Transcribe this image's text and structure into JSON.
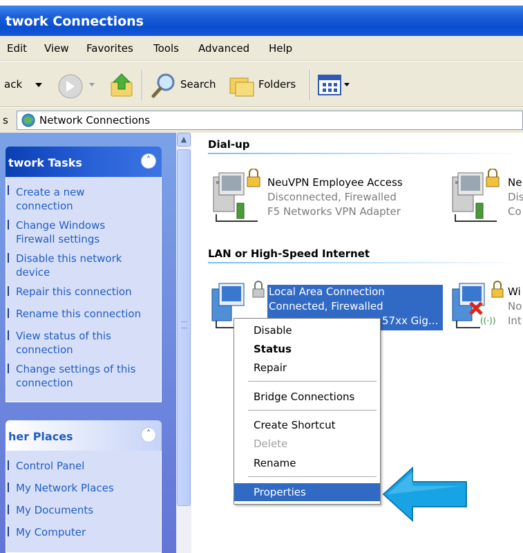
{
  "window": {
    "title": "twork Connections"
  },
  "menubar": {
    "items": [
      "Edit",
      "View",
      "Favorites",
      "Tools",
      "Advanced",
      "Help"
    ]
  },
  "toolbar": {
    "back_label": "ack",
    "search_label": "Search",
    "folders_label": "Folders"
  },
  "address": {
    "prefix": "s",
    "value": "Network Connections"
  },
  "taskpane": {
    "network_tasks": {
      "title": "twork Tasks",
      "items": [
        {
          "line1": "Create a new",
          "line2": "connection"
        },
        {
          "line1": "Change Windows",
          "line2": "Firewall settings"
        },
        {
          "line1": "Disable this network",
          "line2": "device"
        },
        {
          "line1": "Repair this connection",
          "line2": ""
        },
        {
          "line1": "Rename this connection",
          "line2": ""
        },
        {
          "line1": "View status of this",
          "line2": "connection"
        },
        {
          "line1": "Change settings of this",
          "line2": "connection"
        }
      ]
    },
    "other_places": {
      "title": "her Places",
      "items": [
        "Control Panel",
        "My Network Places",
        "My Documents",
        "My Computer"
      ]
    }
  },
  "content": {
    "groups": [
      {
        "title": "Dial-up"
      },
      {
        "title": "LAN or High-Speed Internet"
      }
    ],
    "connections": {
      "vpn": {
        "name": "NeuVPN Employee Access",
        "status": "Disconnected, Firewalled",
        "device": "F5 Networks VPN Adapter"
      },
      "vpn2_partial": {
        "name": "Ne",
        "status": "Dis",
        "device": "Co"
      },
      "lan": {
        "name": "Local Area Connection",
        "status": "Connected, Firewalled",
        "device": "57xx Gig..."
      },
      "wireless_partial": {
        "name": "Wi",
        "status": "No",
        "device": "Int"
      }
    }
  },
  "contextmenu": {
    "disable": "Disable",
    "status": "Status",
    "repair": "Repair",
    "bridge": "Bridge Connections",
    "shortcut": "Create Shortcut",
    "delete": "Delete",
    "rename": "Rename",
    "properties": "Properties"
  },
  "colors": {
    "selection": "#316ac5",
    "titlebar": "#0a4ed0",
    "arrow": "#1aa3e6"
  }
}
